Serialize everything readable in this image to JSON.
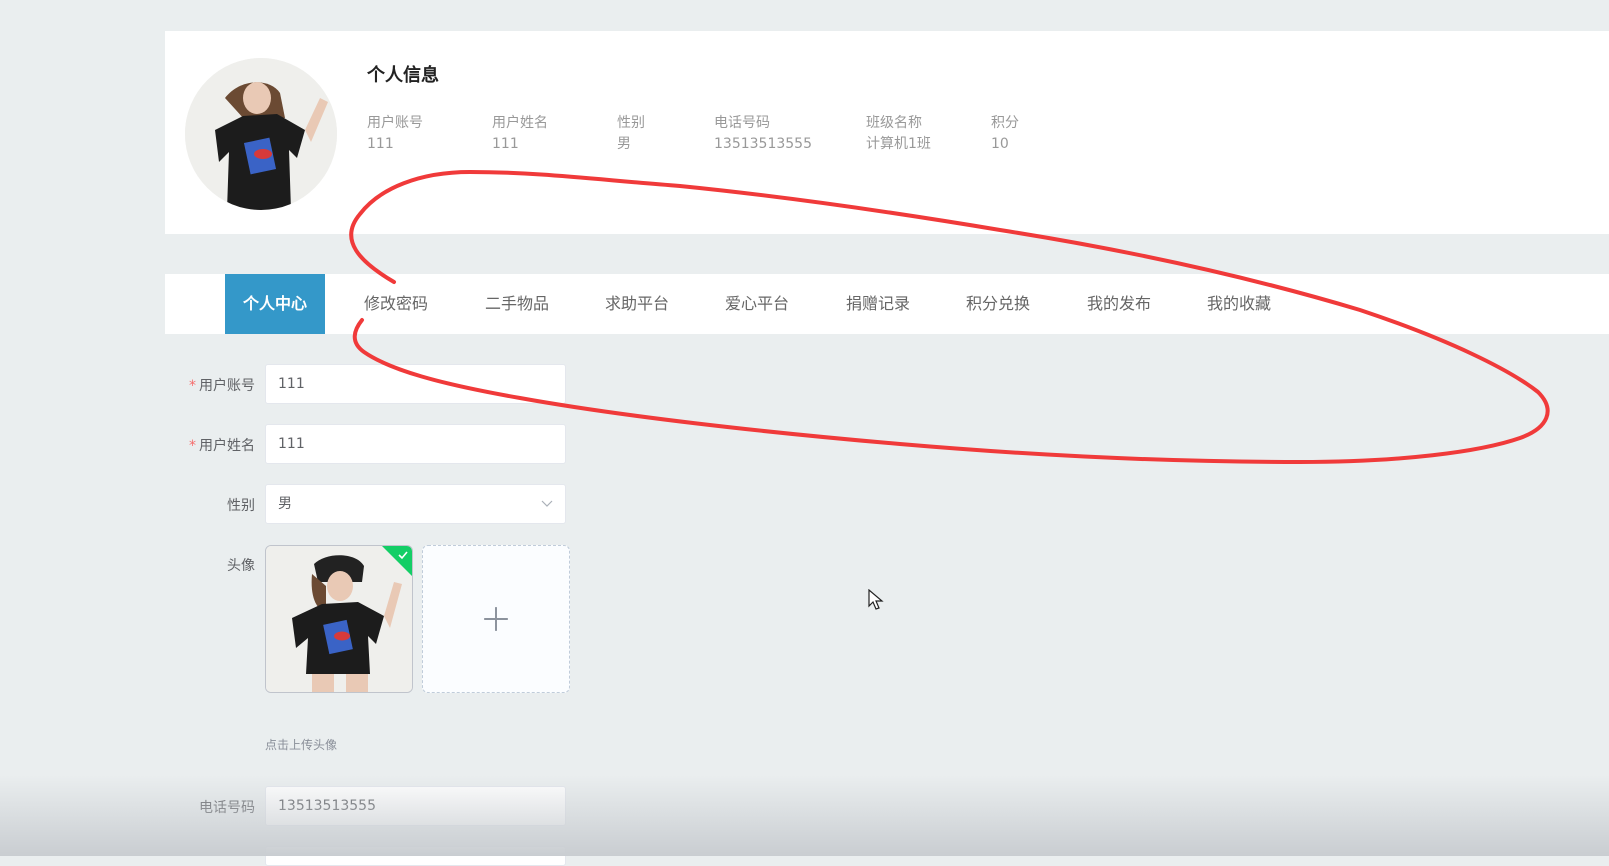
{
  "profile": {
    "title": "个人信息",
    "fields": [
      {
        "label": "用户账号",
        "value": "111"
      },
      {
        "label": "用户姓名",
        "value": "111"
      },
      {
        "label": "性别",
        "value": "男"
      },
      {
        "label": "电话号码",
        "value": "13513513555"
      },
      {
        "label": "班级名称",
        "value": "计算机1班"
      },
      {
        "label": "积分",
        "value": "10"
      }
    ]
  },
  "tabs": [
    "个人中心",
    "修改密码",
    "二手物品",
    "求助平台",
    "爱心平台",
    "捐赠记录",
    "积分兑换",
    "我的发布",
    "我的收藏"
  ],
  "active_tab": "个人中心",
  "form": {
    "account": {
      "label": "用户账号",
      "required_mark": "*",
      "value": "111"
    },
    "name": {
      "label": "用户姓名",
      "required_mark": "*",
      "value": "111"
    },
    "gender": {
      "label": "性别",
      "value": "男"
    },
    "avatar": {
      "label": "头像",
      "upload_hint": "点击上传头像"
    },
    "phone": {
      "label": "电话号码",
      "value": "13513513555"
    }
  },
  "colors": {
    "accent": "#3498c9",
    "required": "#f56c6c",
    "success": "#13ce66",
    "annotation": "#f03a3a"
  }
}
